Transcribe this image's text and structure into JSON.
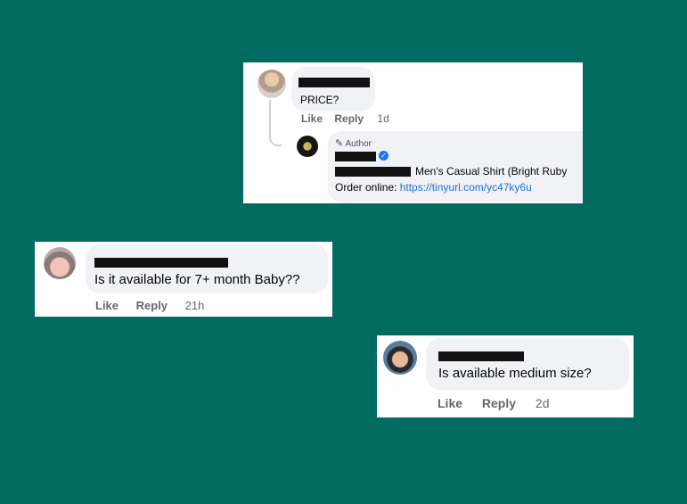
{
  "comment1": {
    "text": "PRICE?",
    "actions": {
      "like": "Like",
      "reply": "Reply",
      "time": "1d"
    },
    "reply": {
      "badge_icon": "pencil-icon",
      "badge_label": "Author",
      "verified_icon": "verified-badge-icon",
      "line1_text": "Men's Casual Shirt (Bright Ruby",
      "line2_prefix": "Order online: ",
      "link": "https://tinyurl.com/yc47ky6u"
    }
  },
  "comment2": {
    "text": "Is it available for 7+ month Baby??",
    "actions": {
      "like": "Like",
      "reply": "Reply",
      "time": "21h"
    }
  },
  "comment3": {
    "text": "Is available medium size?",
    "actions": {
      "like": "Like",
      "reply": "Reply",
      "time": "2d"
    }
  },
  "colors": {
    "background": "#006b61",
    "bubble": "#f0f2f5",
    "link": "#216fdb",
    "verified": "#1877f2",
    "muted": "#65676b"
  }
}
